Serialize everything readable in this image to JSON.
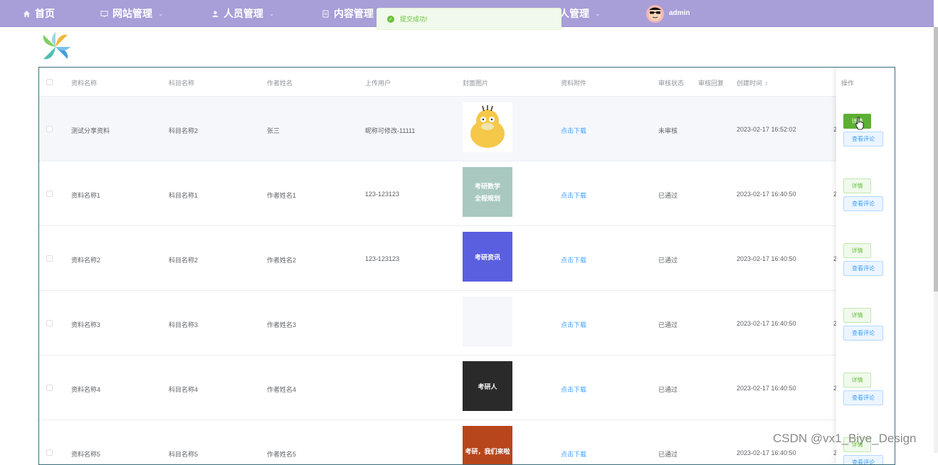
{
  "nav": {
    "items": [
      {
        "label": "首页",
        "icon": "home-icon",
        "has_dropdown": false
      },
      {
        "label": "网站管理",
        "icon": "monitor-icon",
        "has_dropdown": true
      },
      {
        "label": "人员管理",
        "icon": "user-icon",
        "has_dropdown": true
      },
      {
        "label": "内容管理",
        "icon": "document-icon",
        "has_dropdown": false
      },
      {
        "label": "人管理",
        "icon": "",
        "has_dropdown": true
      }
    ],
    "username": "admin"
  },
  "toast": {
    "message": "提交成功!",
    "type": "success"
  },
  "table": {
    "headers": {
      "name": "资料名称",
      "subject": "科目名称",
      "author": "作者姓名",
      "uploader": "上传用户",
      "cover": "封面图片",
      "attachment": "资料附件",
      "status": "审核状态",
      "reply": "审核回复",
      "created": "创建时间",
      "actions": "操作"
    },
    "rows": [
      {
        "name": "测试分享资料",
        "subject": "科目名称2",
        "author": "张三",
        "uploader": "昵称可修改-11111",
        "attachment": "点击下载",
        "status": "未审核",
        "reply": "",
        "created": "2023-02-17 16:52:02",
        "edge": "2"
      },
      {
        "name": "资料名称1",
        "subject": "科目名称1",
        "author": "作者姓名1",
        "uploader": "123-123123",
        "attachment": "点击下载",
        "status": "已通过",
        "reply": "",
        "created": "2023-02-17 16:40:50",
        "edge": "2"
      },
      {
        "name": "资料名称2",
        "subject": "科目名称2",
        "author": "作者姓名2",
        "uploader": "123-123123",
        "attachment": "点击下载",
        "status": "已通过",
        "reply": "",
        "created": "2023-02-17 16:40:50",
        "edge": "2"
      },
      {
        "name": "资料名称3",
        "subject": "科目名称3",
        "author": "作者姓名3",
        "uploader": "",
        "attachment": "点击下载",
        "status": "已通过",
        "reply": "",
        "created": "2023-02-17 16:40:50",
        "edge": "2"
      },
      {
        "name": "资料名称4",
        "subject": "科目名称4",
        "author": "作者姓名4",
        "uploader": "",
        "attachment": "点击下载",
        "status": "已通过",
        "reply": "",
        "created": "2023-02-17 16:40:50",
        "edge": "2"
      },
      {
        "name": "资料名称5",
        "subject": "科目名称5",
        "author": "作者姓名5",
        "uploader": "",
        "attachment": "点击下载",
        "status": "已通过",
        "reply": "",
        "created": "2023-02-17 16:40:50",
        "edge": "2"
      }
    ],
    "covers": [
      {
        "kind": "psyduck"
      },
      {
        "kind": "text",
        "lines": [
          "考研数学",
          "全程规划"
        ],
        "bg": "#a8c8c0"
      },
      {
        "kind": "text",
        "lines": [
          "考研资讯"
        ],
        "bg": "#5a5fe0"
      },
      {
        "kind": "empty"
      },
      {
        "kind": "text",
        "lines": [
          "考研人"
        ],
        "bg": "#2a2a2a"
      },
      {
        "kind": "text",
        "lines": [
          "考研，我们来啦"
        ],
        "bg": "#b8461c"
      }
    ],
    "action_labels": {
      "detail": "详情",
      "review": "查看评论"
    }
  },
  "watermark": "CSDN @vx1_Biye_Design"
}
